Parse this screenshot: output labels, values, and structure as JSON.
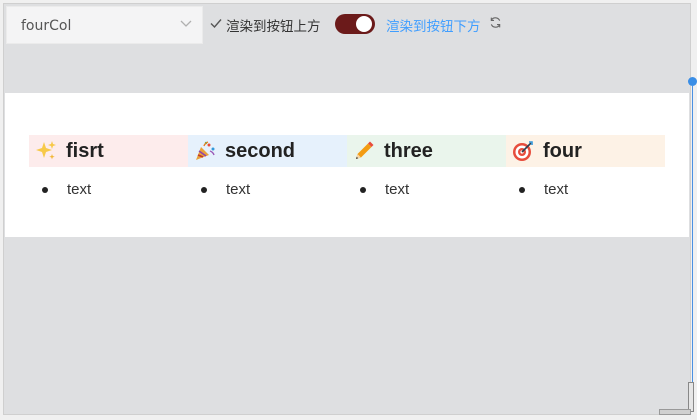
{
  "toolbar": {
    "select_value": "fourCol",
    "render_above_label": "渲染到按钮上方",
    "render_below_label": "渲染到按钮下方",
    "toggle_on": true
  },
  "columns": [
    {
      "title": "fisrt",
      "icon": "sparkles-icon",
      "bg": "#fdecec",
      "items": [
        "text"
      ]
    },
    {
      "title": "second",
      "icon": "party-popper-icon",
      "bg": "#e6f1fc",
      "items": [
        "text"
      ]
    },
    {
      "title": "three",
      "icon": "pencil-icon",
      "bg": "#eaf5ec",
      "items": [
        "text"
      ]
    },
    {
      "title": "four",
      "icon": "target-icon",
      "bg": "#fdf2e6",
      "items": [
        "text"
      ]
    }
  ],
  "colors": {
    "toggle": "#6b1a1a",
    "link": "#409eff",
    "canvas": "#dedfe1"
  }
}
